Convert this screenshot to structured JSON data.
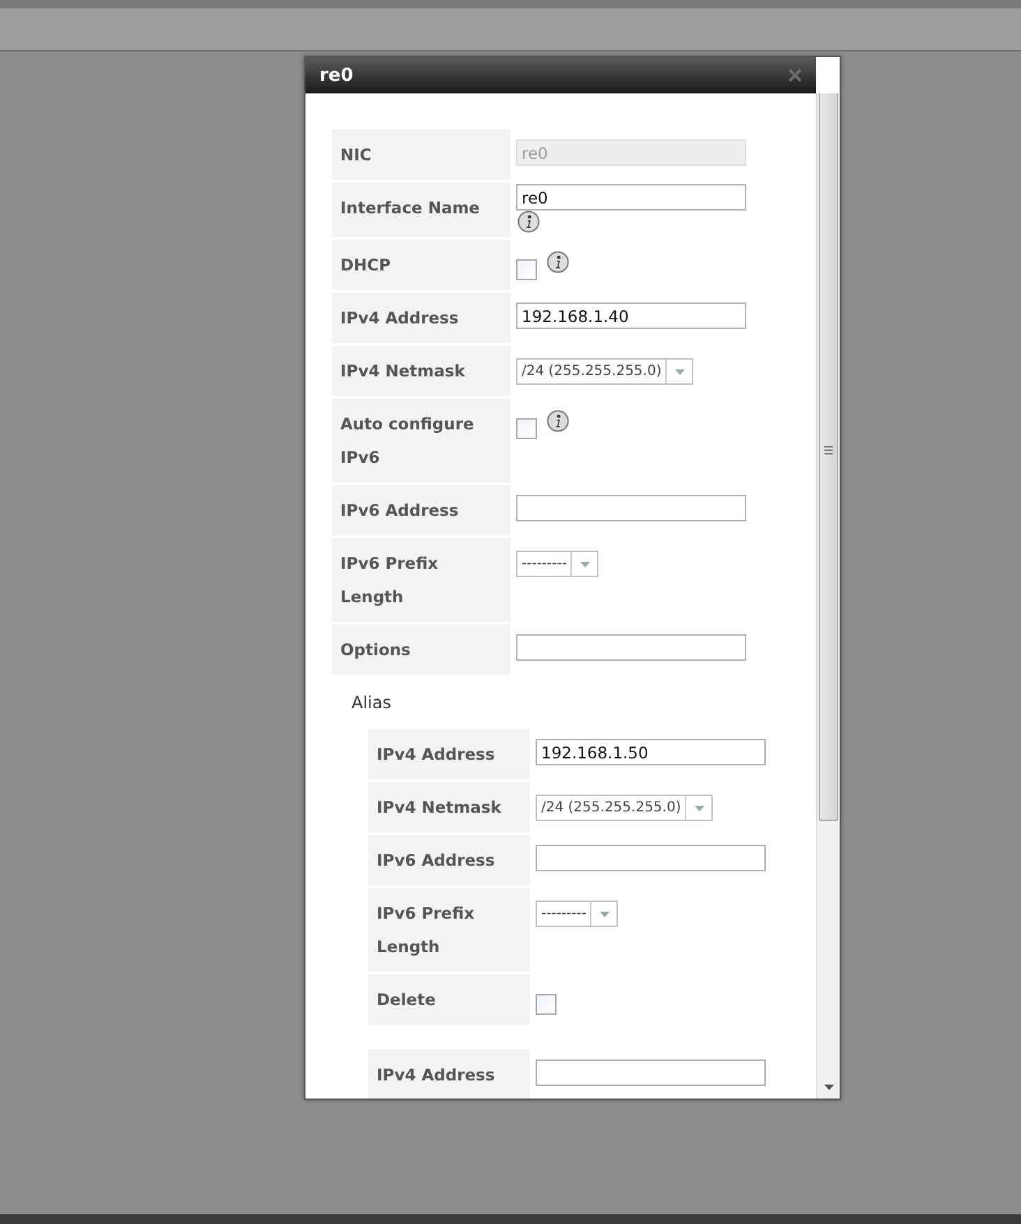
{
  "dialog": {
    "title": "re0",
    "fields": [
      {
        "kind": "text",
        "label": "NIC",
        "value": "re0",
        "disabled": true
      },
      {
        "kind": "text",
        "label": "Interface Name",
        "value": "re0",
        "disabled": false,
        "info": true
      },
      {
        "kind": "checkbox",
        "label": "DHCP",
        "checked": false,
        "info": true
      },
      {
        "kind": "text",
        "label": "IPv4 Address",
        "value": "192.168.1.40",
        "disabled": false
      },
      {
        "kind": "select",
        "label": "IPv4 Netmask",
        "value": "/24 (255.255.255.0)"
      },
      {
        "kind": "checkbox",
        "label": "Auto configure IPv6",
        "checked": false,
        "info": true
      },
      {
        "kind": "text",
        "label": "IPv6 Address",
        "disabled": false
      },
      {
        "kind": "select",
        "label": "IPv6 Prefix Length",
        "value": "---------"
      },
      {
        "kind": "text",
        "label": "Options",
        "disabled": false
      }
    ],
    "alias_heading": "Alias",
    "alias_groups": [
      {
        "fields": [
          {
            "kind": "text",
            "label": "IPv4 Address",
            "value": "192.168.1.50",
            "disabled": false
          },
          {
            "kind": "select",
            "label": "IPv4 Netmask",
            "value": "/24 (255.255.255.0)"
          },
          {
            "kind": "text",
            "label": "IPv6 Address",
            "disabled": false
          },
          {
            "kind": "select",
            "label": "IPv6 Prefix Length",
            "value": "---------"
          },
          {
            "kind": "checkbox",
            "label": "Delete",
            "checked": false
          }
        ]
      },
      {
        "fields": [
          {
            "kind": "text",
            "label": "IPv4 Address",
            "disabled": false
          }
        ]
      }
    ]
  }
}
